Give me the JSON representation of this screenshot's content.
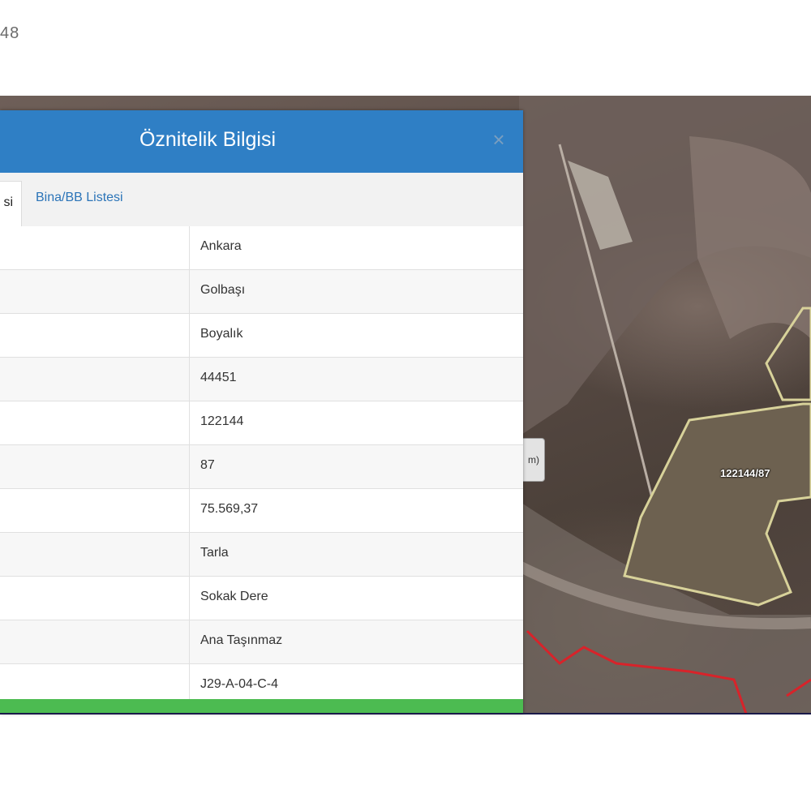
{
  "page": {
    "corner_text": "48"
  },
  "map": {
    "parcel_label": "122144/87",
    "control_label": "m)"
  },
  "panel": {
    "title": "Öznitelik Bilgisi",
    "close_symbol": "×",
    "tabs": [
      {
        "label": "si",
        "active": true
      },
      {
        "label": "Bina/BB Listesi",
        "active": false
      }
    ],
    "rows": [
      {
        "value": "Ankara"
      },
      {
        "value": "Golbaşı"
      },
      {
        "value": "Boyalık"
      },
      {
        "value": "44451"
      },
      {
        "value": "122144"
      },
      {
        "value": "87"
      },
      {
        "value": "75.569,37"
      },
      {
        "value": "Tarla"
      },
      {
        "value": "Sokak Dere"
      },
      {
        "value": "Ana Taşınmaz"
      },
      {
        "value": "J29-A-04-C-4"
      }
    ]
  },
  "colors": {
    "header": "#2f7fc5",
    "footer_bar": "#4cbb51",
    "tab_link": "#2b74b8",
    "parcel_outline": "#d8d29a",
    "boundary": "#d8232a"
  }
}
